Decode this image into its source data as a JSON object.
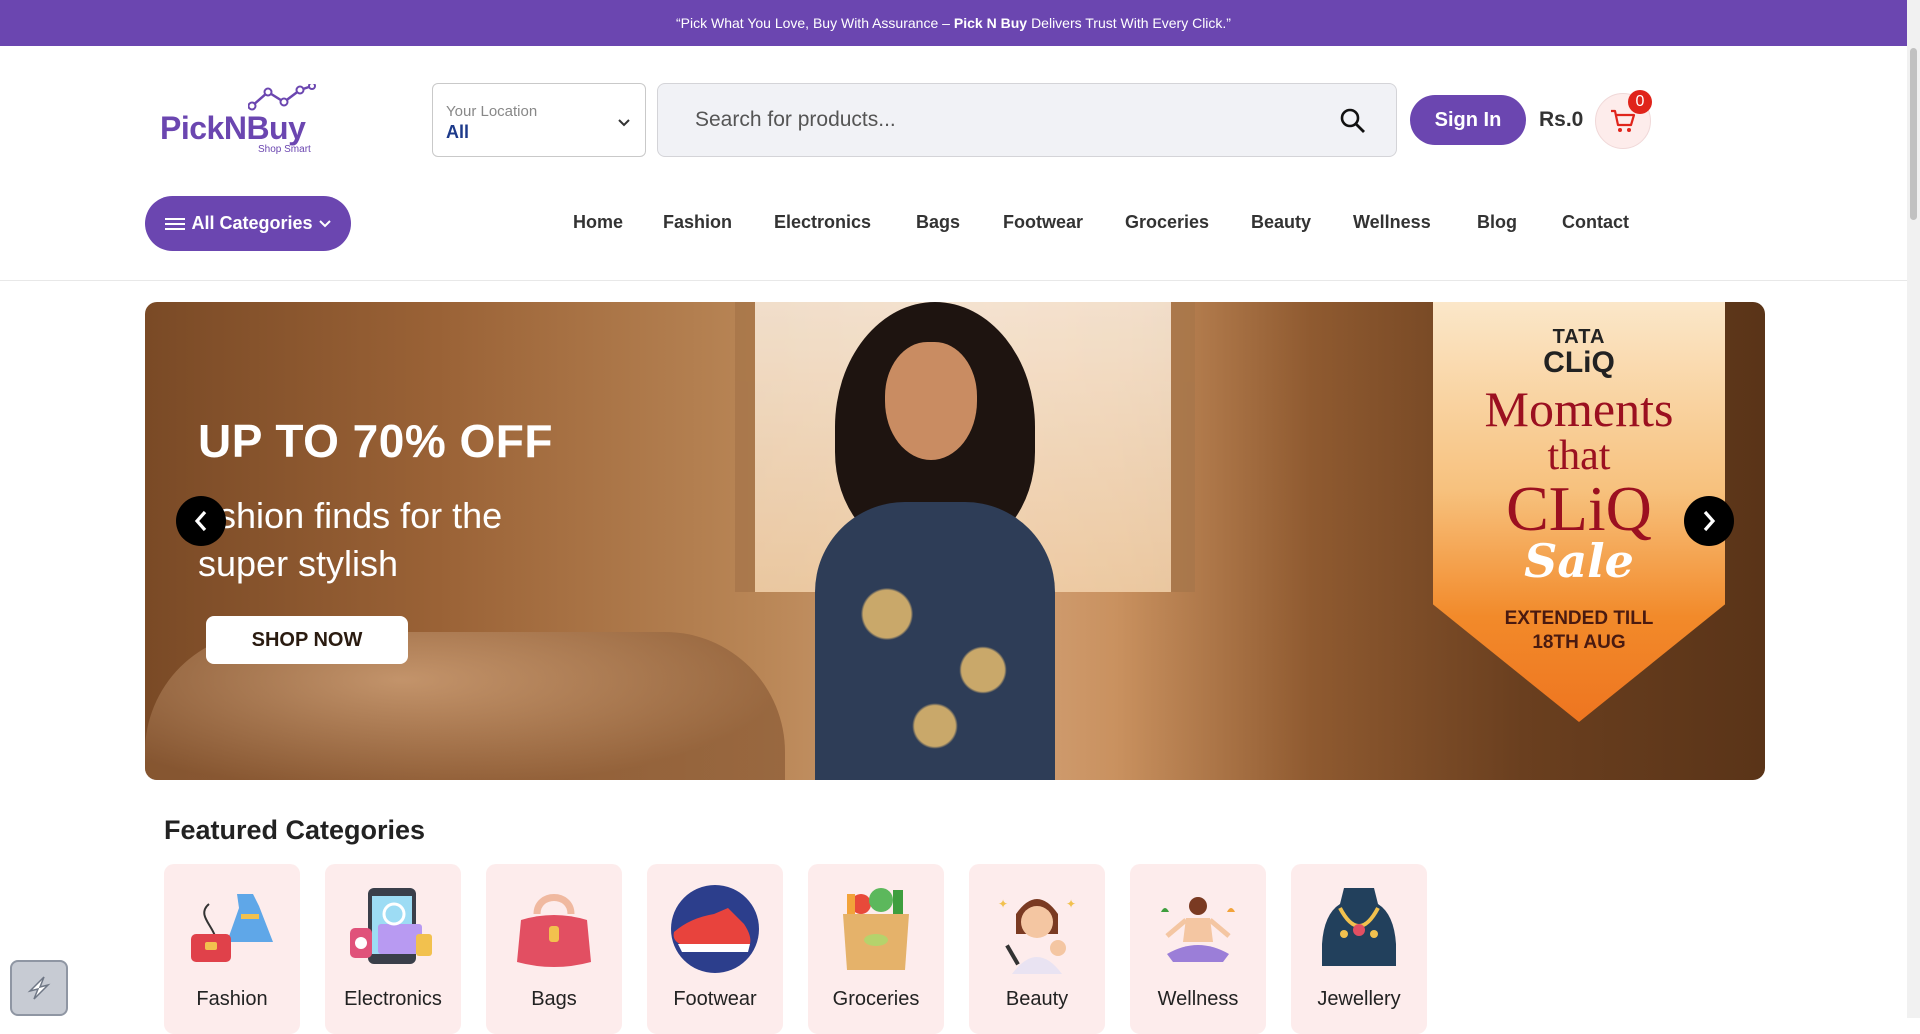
{
  "topbar": {
    "part1": "“Pick What You Love, Buy With Assurance –",
    "brand": "Pick N Buy",
    "part2": "Delivers Trust With Every Click.”"
  },
  "header": {
    "logo_name": "PickNBuy",
    "logo_tag": "Shop Smart",
    "location_label": "Your Location",
    "location_value": "All",
    "search_placeholder": "Search for products...",
    "signin_label": "Sign In",
    "cart_total": "Rs.0",
    "cart_count": "0"
  },
  "nav": {
    "all_categories": "All Categories",
    "items": [
      "Home",
      "Fashion",
      "Electronics",
      "Bags",
      "Footwear",
      "Groceries",
      "Beauty",
      "Wellness",
      "Blog",
      "Contact"
    ]
  },
  "banner": {
    "headline": "UP TO 70% OFF",
    "sub": "ashion finds for the super stylish",
    "button": "SHOP NOW",
    "promo_brand": "TATA",
    "promo_cliq": "CLiQ",
    "promo_moments": "Moments",
    "promo_that": "that",
    "promo_cliq2": "CLiQ",
    "promo_sale": "Sale",
    "promo_extended": "EXTENDED TILL",
    "promo_date": "18TH AUG"
  },
  "featured": {
    "title": "Featured Categories",
    "categories": [
      "Fashion",
      "Electronics",
      "Bags",
      "Footwear",
      "Groceries",
      "Beauty",
      "Wellness",
      "Jewellery"
    ]
  },
  "colors": {
    "brand": "#6b46b0",
    "badge": "#e0241b",
    "category_bg": "#fdecec"
  }
}
